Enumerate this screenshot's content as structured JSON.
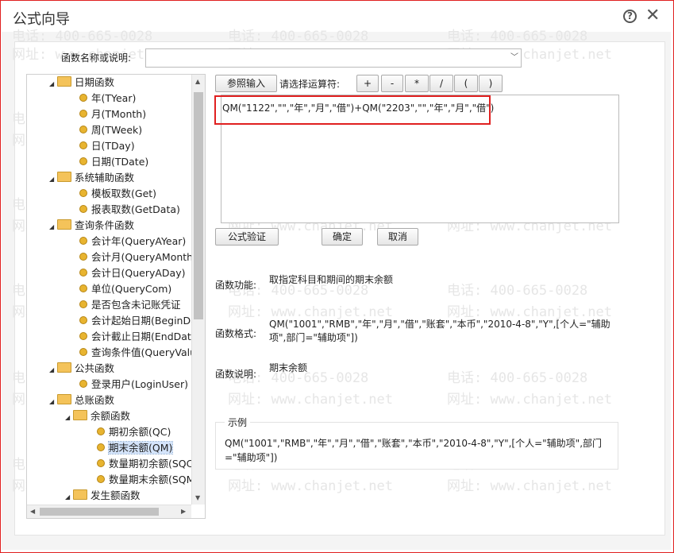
{
  "window": {
    "title": "公式向导",
    "help_glyph": "?",
    "close_glyph": "✕"
  },
  "watermark": {
    "phone": "电话: 400-665-0028",
    "site": "网址: www.chanjet.net"
  },
  "search": {
    "label": "函数名称或说明:",
    "value": "",
    "arrow": "﹀"
  },
  "tree": {
    "items": [
      {
        "label": "日期函数",
        "type": "folder",
        "level": 0
      },
      {
        "label": "年(TYear)",
        "type": "leaf",
        "level": 1
      },
      {
        "label": "月(TMonth)",
        "type": "leaf",
        "level": 1
      },
      {
        "label": "周(TWeek)",
        "type": "leaf",
        "level": 1
      },
      {
        "label": "日(TDay)",
        "type": "leaf",
        "level": 1
      },
      {
        "label": "日期(TDate)",
        "type": "leaf",
        "level": 1
      },
      {
        "label": "系统辅助函数",
        "type": "folder",
        "level": 0
      },
      {
        "label": "模板取数(Get)",
        "type": "leaf",
        "level": 1
      },
      {
        "label": "报表取数(GetData)",
        "type": "leaf",
        "level": 1
      },
      {
        "label": "查询条件函数",
        "type": "folder",
        "level": 0
      },
      {
        "label": "会计年(QueryAYear)",
        "type": "leaf",
        "level": 1
      },
      {
        "label": "会计月(QueryAMonth)",
        "type": "leaf",
        "level": 1
      },
      {
        "label": "会计日(QueryADay)",
        "type": "leaf",
        "level": 1
      },
      {
        "label": "单位(QueryCom)",
        "type": "leaf",
        "level": 1
      },
      {
        "label": "是否包含未记账凭证",
        "type": "leaf",
        "level": 1
      },
      {
        "label": "会计起始日期(BeginDate)",
        "type": "leaf",
        "level": 1
      },
      {
        "label": "会计截止日期(EndDate)",
        "type": "leaf",
        "level": 1
      },
      {
        "label": "查询条件值(QueryValue)",
        "type": "leaf",
        "level": 1
      },
      {
        "label": "公共函数",
        "type": "folder",
        "level": 0
      },
      {
        "label": "登录用户(LoginUser)",
        "type": "leaf",
        "level": 1
      },
      {
        "label": "总账函数",
        "type": "folder",
        "level": 0
      },
      {
        "label": "余额函数",
        "type": "folder",
        "level": 1
      },
      {
        "label": "期初余额(QC)",
        "type": "leaf",
        "level": 2
      },
      {
        "label": "期末余额(QM)",
        "type": "leaf",
        "level": 2,
        "selected": true
      },
      {
        "label": "数量期初余额(SQC)",
        "type": "leaf",
        "level": 2
      },
      {
        "label": "数量期末余额(SQM)",
        "type": "leaf",
        "level": 2
      },
      {
        "label": "发生额函数",
        "type": "folder",
        "level": 1
      }
    ]
  },
  "toolbar": {
    "ref_input_label": "参照输入",
    "operator_label": "请选择运算符:",
    "operators": [
      "+",
      "-",
      "*",
      "/",
      "(",
      ")"
    ]
  },
  "formula": {
    "value": "QM(\"1122\",\"\",\"年\",\"月\",\"借\")+QM(\"2203\",\"\",\"年\",\"月\",\"借\")"
  },
  "actions": {
    "verify_label": "公式验证",
    "ok_label": "确定",
    "cancel_label": "取消"
  },
  "info": {
    "function_label": "函数功能:",
    "function_value": "取指定科目和期间的期末余额",
    "format_label": "函数格式:",
    "format_value": "QM(\"1001\",\"RMB\",\"年\",\"月\",\"借\",\"账套\",\"本币\",\"2010-4-8\",\"Y\",[个人=\"辅助项\",部门=\"辅助项\"])",
    "desc_label": "函数说明:",
    "desc_value": "期末余额"
  },
  "example": {
    "title": "示例",
    "text": "QM(\"1001\",\"RMB\",\"年\",\"月\",\"借\",\"账套\",\"本币\",\"2010-4-8\",\"Y\",[个人=\"辅助项\",部门=\"辅助项\"])"
  }
}
